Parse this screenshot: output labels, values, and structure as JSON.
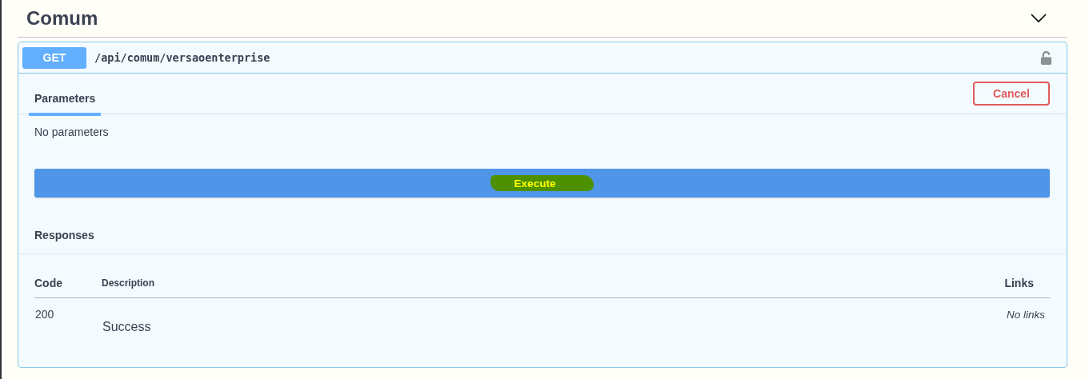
{
  "section": {
    "title": "Comum",
    "expanded": true
  },
  "operation": {
    "method": "GET",
    "path": "/api/comum/versaoenterprise",
    "locked": false
  },
  "tabs": [
    {
      "label": "Parameters",
      "selected": true
    }
  ],
  "cancel_button": "Cancel",
  "parameters_text": "No parameters",
  "execute_button": "Execute",
  "responses_title": "Responses",
  "responses_table": {
    "columns": [
      "Code",
      "Description",
      "Links"
    ],
    "rows": [
      {
        "code": "200",
        "description": "Success",
        "links": "No links"
      }
    ]
  }
}
